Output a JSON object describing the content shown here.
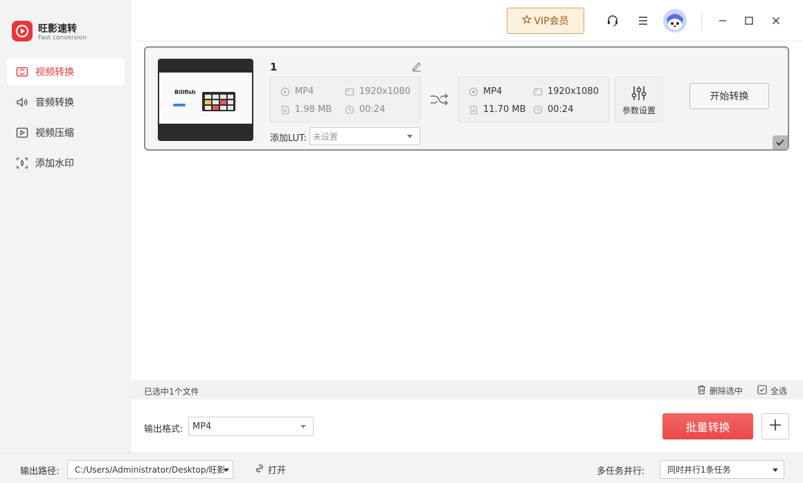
{
  "app": {
    "name": "旺影速转",
    "subtitle": "Fast conversion"
  },
  "sidebar": {
    "items": [
      {
        "label": "视频转换",
        "icon": "video-convert-icon",
        "active": true
      },
      {
        "label": "音频转换",
        "icon": "audio-icon",
        "active": false
      },
      {
        "label": "视频压缩",
        "icon": "video-compress-icon",
        "active": false
      },
      {
        "label": "添加水印",
        "icon": "watermark-icon",
        "active": false
      }
    ]
  },
  "topbar": {
    "vip_label": "VIP会员",
    "icons": [
      "headset-icon",
      "menu-icon",
      "avatar",
      "minimize-icon",
      "maximize-icon",
      "close-icon"
    ]
  },
  "file_card": {
    "name": "1",
    "thumbnail_text": "Billfish",
    "source": {
      "format": "MP4",
      "resolution": "1920x1080",
      "size": "1.98 MB",
      "duration": "00:24"
    },
    "output": {
      "format": "MP4",
      "resolution": "1920x1080",
      "size": "11.70 MB",
      "duration": "00:24"
    },
    "params_label": "参数设置",
    "start_label": "开始转换",
    "lut_label": "添加LUT:",
    "lut_value": "未设置"
  },
  "statusbar": {
    "selected_text": "已选中1个文件",
    "delete_label": "删除选中",
    "select_all_label": "全选"
  },
  "bottom": {
    "format_label": "输出格式:",
    "format_value": "MP4",
    "batch_label": "批量转换"
  },
  "footer": {
    "path_label": "输出路径:",
    "path_value": "C:/Users/Administrator/Desktop/旺影",
    "open_label": "打开",
    "parallel_label": "多任务并行:",
    "parallel_value": "同时并行1条任务"
  },
  "colors": {
    "accent": "#e8373b",
    "vip_bg": "#fdf0dc",
    "vip_border": "#d8a45e",
    "batch_btn": "#ef5556"
  }
}
